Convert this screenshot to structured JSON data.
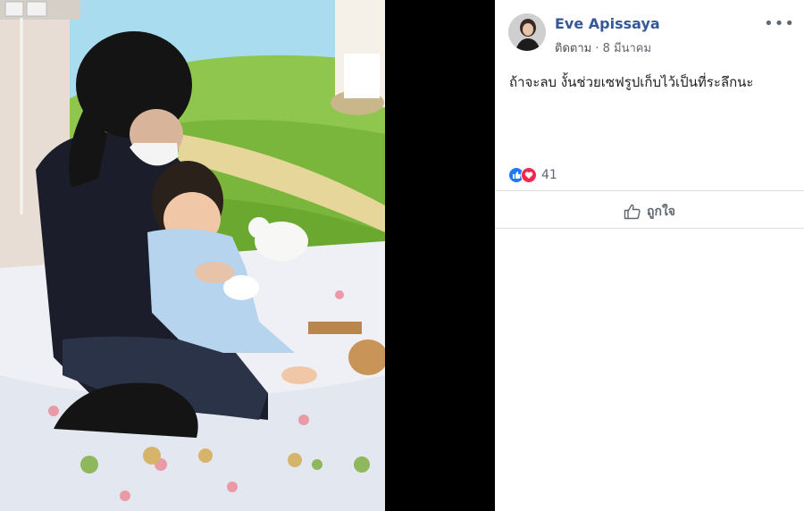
{
  "post": {
    "author": "Eve Apissaya",
    "follow_label": "ติดตาม",
    "separator": "·",
    "date": "8 มีนาคม",
    "text": "ถ้าจะลบ งั้นช่วยเซฟรูปเก็บไว้เป็นที่ระลึกนะ",
    "more_label": "•••"
  },
  "reactions": {
    "count": "41",
    "icons": [
      "like-icon",
      "love-icon"
    ],
    "colors": {
      "like": "#2078f4",
      "love": "#f0284a"
    }
  },
  "actions": {
    "like_label": "ถูกใจ"
  },
  "theme": {
    "author_color": "#365899",
    "meta_color": "#616770"
  }
}
